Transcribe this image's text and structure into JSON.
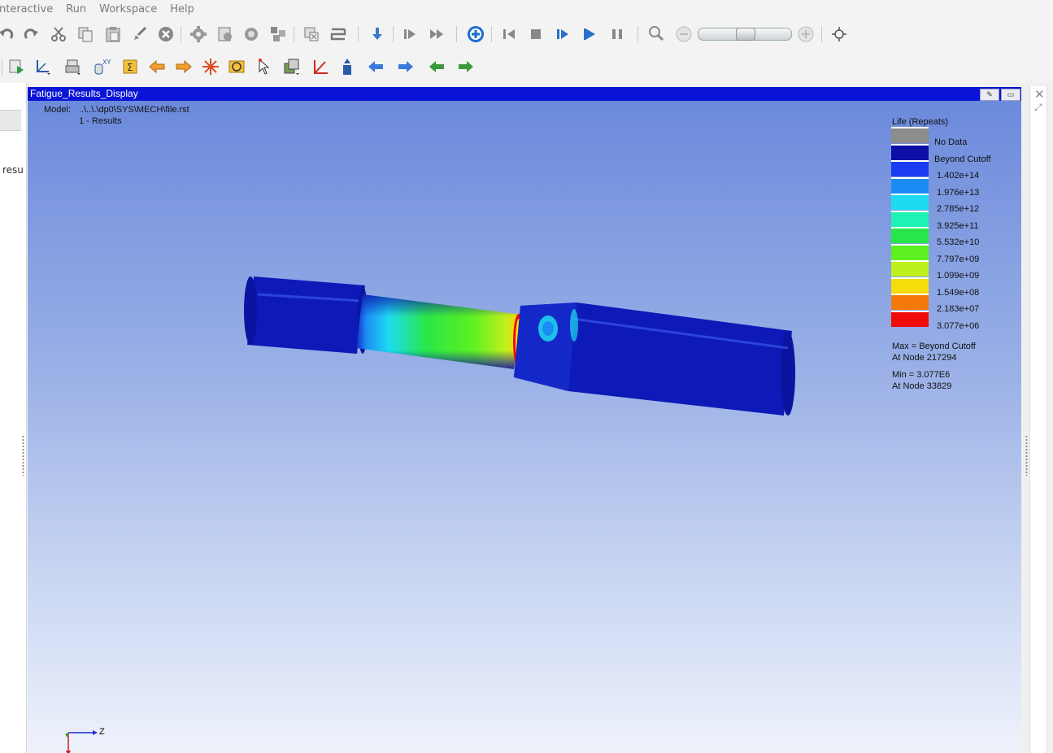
{
  "menu": [
    {
      "label": "nteractive"
    },
    {
      "label": "Run"
    },
    {
      "label": "Workspace"
    },
    {
      "label": "Help"
    }
  ],
  "left_panel": {
    "cut_text": "resu"
  },
  "viewport": {
    "title": "Fatigue_Results_Display",
    "model_key": "Model:",
    "model_path": "..\\..\\.\\dp0\\SYS\\MECH\\file.rst",
    "result_set": "1 - Results"
  },
  "legend": {
    "title": "Life (Repeats)",
    "entries": [
      {
        "color": "#8c8c8c",
        "label": "No Data"
      },
      {
        "color": "#0b0fa6",
        "label": "Beyond Cutoff"
      },
      {
        "color": "#1a3cf0",
        "label": "1.402e+14"
      },
      {
        "color": "#1c8cf5",
        "label": "1.976e+13"
      },
      {
        "color": "#1edcf0",
        "label": "2.785e+12"
      },
      {
        "color": "#1ef2b4",
        "label": "3.925e+11"
      },
      {
        "color": "#28e64a",
        "label": "5.532e+10"
      },
      {
        "color": "#5cf020",
        "label": "7.797e+09"
      },
      {
        "color": "#bef01e",
        "label": "1.099e+09"
      },
      {
        "color": "#f5dc0a",
        "label": "1.549e+08"
      },
      {
        "color": "#f5780a",
        "label": "2.183e+07"
      },
      {
        "color": "#f00a0a",
        "label": "3.077e+06"
      }
    ],
    "max_line1": "Max = Beyond Cutoff",
    "max_line2": "At Node 217294",
    "min_line1": "Min = 3.077E6",
    "min_line2": "At Node 33829"
  },
  "triad": {
    "axis_label": "Z"
  }
}
